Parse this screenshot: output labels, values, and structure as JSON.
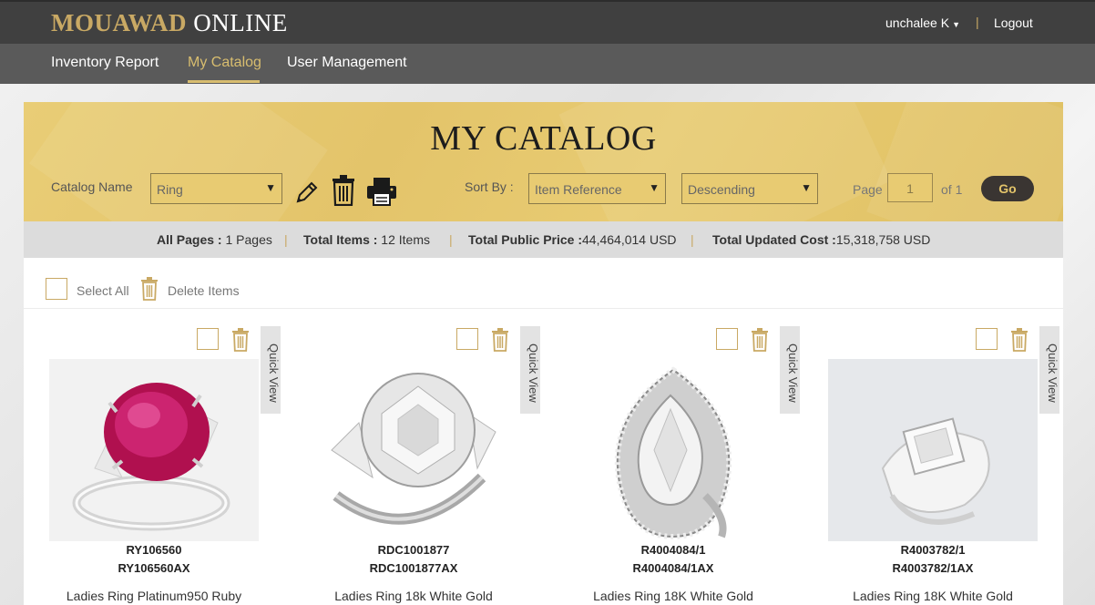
{
  "header": {
    "brand_gold": "MOUAWAD",
    "brand_white": "ONLINE",
    "user_name": "unchalee K",
    "divider": "|",
    "logout_label": "Logout"
  },
  "nav": {
    "items": [
      {
        "label": "Inventory Report",
        "active": false
      },
      {
        "label": "My Catalog",
        "active": true
      },
      {
        "label": "User Management",
        "active": false
      }
    ]
  },
  "catalog": {
    "title": "MY CATALOG",
    "catalog_name_label": "Catalog Name",
    "catalog_name_value": "Ring",
    "sort_by_label": "Sort By :",
    "sort_field_value": "Item Reference",
    "sort_order_value": "Descending",
    "page_label": "Page",
    "page_value": "1",
    "of_label": "of 1",
    "go_label": "Go"
  },
  "stats": {
    "all_pages_label": "All Pages :",
    "all_pages_value": " 1 Pages",
    "total_items_label": "Total Items :",
    "total_items_value": " 12 Items",
    "total_public_price_label": "Total Public Price :",
    "total_public_price_value": "44,464,014 USD",
    "total_updated_cost_label": "Total Updated Cost :",
    "total_updated_cost_value": "15,318,758 USD",
    "separator": "|"
  },
  "actions": {
    "select_all_label": "Select All",
    "delete_items_label": "Delete Items"
  },
  "products": [
    {
      "code1": "RY106560",
      "code2": "RY106560AX",
      "desc": "Ladies Ring Platinum950 Ruby",
      "quick_view": "Quick View"
    },
    {
      "code1": "RDC1001877",
      "code2": "RDC1001877AX",
      "desc": "Ladies Ring 18k White Gold",
      "quick_view": "Quick View"
    },
    {
      "code1": "R4004084/1",
      "code2": "R4004084/1AX",
      "desc": "Ladies Ring 18K White Gold",
      "quick_view": "Quick View"
    },
    {
      "code1": "R4003782/1",
      "code2": "R4003782/1AX",
      "desc": "Ladies Ring 18K White Gold",
      "quick_view": "Quick View"
    }
  ],
  "colors": {
    "gold": "#c9a964",
    "gold_header": "#e5c76e",
    "dark_bar": "#404040",
    "nav_bar": "#5a5a5a",
    "go_button": "#3a3532"
  }
}
